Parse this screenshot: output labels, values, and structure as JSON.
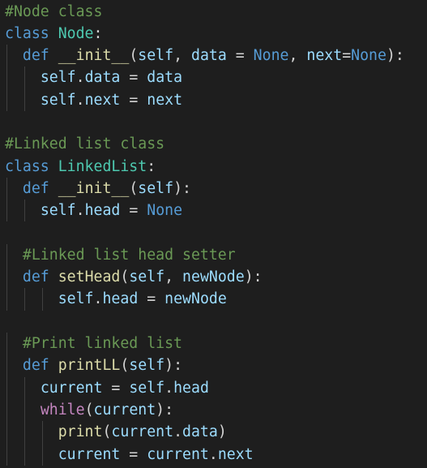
{
  "editor": {
    "colors": {
      "background": "#1e1e1e",
      "comment": "#6a9955",
      "keyword": "#569cd6",
      "class_name": "#4ec9b0",
      "function": "#dcdcaa",
      "variable": "#9cdcfe",
      "control": "#c586c0",
      "text": "#d4d4d4",
      "indent_guide": "#404040"
    },
    "lines": [
      {
        "indent": 0,
        "tokens": [
          {
            "t": "#Node class",
            "c": "comment"
          }
        ]
      },
      {
        "indent": 0,
        "tokens": [
          {
            "t": "class",
            "c": "keyword"
          },
          {
            "t": " ",
            "c": "plain"
          },
          {
            "t": "Node",
            "c": "classname"
          },
          {
            "t": ":",
            "c": "plain"
          }
        ]
      },
      {
        "indent": 1,
        "tokens": [
          {
            "t": "def",
            "c": "keyword"
          },
          {
            "t": " ",
            "c": "plain"
          },
          {
            "t": "__init__",
            "c": "func"
          },
          {
            "t": "(",
            "c": "plain"
          },
          {
            "t": "self",
            "c": "param"
          },
          {
            "t": ", ",
            "c": "plain"
          },
          {
            "t": "data",
            "c": "param"
          },
          {
            "t": " = ",
            "c": "plain"
          },
          {
            "t": "None",
            "c": "const"
          },
          {
            "t": ", ",
            "c": "plain"
          },
          {
            "t": "next",
            "c": "param"
          },
          {
            "t": "=",
            "c": "plain"
          },
          {
            "t": "None",
            "c": "const"
          },
          {
            "t": "):",
            "c": "plain"
          }
        ]
      },
      {
        "indent": 2,
        "tokens": [
          {
            "t": "self",
            "c": "param"
          },
          {
            "t": ".",
            "c": "plain"
          },
          {
            "t": "data",
            "c": "param"
          },
          {
            "t": " = ",
            "c": "plain"
          },
          {
            "t": "data",
            "c": "param"
          }
        ]
      },
      {
        "indent": 2,
        "tokens": [
          {
            "t": "self",
            "c": "param"
          },
          {
            "t": ".",
            "c": "plain"
          },
          {
            "t": "next",
            "c": "param"
          },
          {
            "t": " = ",
            "c": "plain"
          },
          {
            "t": "next",
            "c": "param"
          }
        ]
      },
      {
        "indent": 0,
        "tokens": []
      },
      {
        "indent": 0,
        "tokens": [
          {
            "t": "#Linked list class",
            "c": "comment"
          }
        ]
      },
      {
        "indent": 0,
        "tokens": [
          {
            "t": "class",
            "c": "keyword"
          },
          {
            "t": " ",
            "c": "plain"
          },
          {
            "t": "LinkedList",
            "c": "classname"
          },
          {
            "t": ":",
            "c": "plain"
          }
        ]
      },
      {
        "indent": 1,
        "tokens": [
          {
            "t": "def",
            "c": "keyword"
          },
          {
            "t": " ",
            "c": "plain"
          },
          {
            "t": "__init__",
            "c": "func"
          },
          {
            "t": "(",
            "c": "plain"
          },
          {
            "t": "self",
            "c": "param"
          },
          {
            "t": "):",
            "c": "plain"
          }
        ]
      },
      {
        "indent": 2,
        "tokens": [
          {
            "t": "self",
            "c": "param"
          },
          {
            "t": ".",
            "c": "plain"
          },
          {
            "t": "head",
            "c": "param"
          },
          {
            "t": " = ",
            "c": "plain"
          },
          {
            "t": "None",
            "c": "const"
          }
        ]
      },
      {
        "indent": 0,
        "tokens": []
      },
      {
        "indent": 1,
        "tokens": [
          {
            "t": "#Linked list head setter",
            "c": "comment"
          }
        ]
      },
      {
        "indent": 1,
        "tokens": [
          {
            "t": "def",
            "c": "keyword"
          },
          {
            "t": " ",
            "c": "plain"
          },
          {
            "t": "setHead",
            "c": "func"
          },
          {
            "t": "(",
            "c": "plain"
          },
          {
            "t": "self",
            "c": "param"
          },
          {
            "t": ", ",
            "c": "plain"
          },
          {
            "t": "newNode",
            "c": "param"
          },
          {
            "t": "):",
            "c": "plain"
          }
        ]
      },
      {
        "indent": 3,
        "tokens": [
          {
            "t": "self",
            "c": "param"
          },
          {
            "t": ".",
            "c": "plain"
          },
          {
            "t": "head",
            "c": "param"
          },
          {
            "t": " = ",
            "c": "plain"
          },
          {
            "t": "newNode",
            "c": "param"
          }
        ]
      },
      {
        "indent": 0,
        "tokens": []
      },
      {
        "indent": 1,
        "tokens": [
          {
            "t": "#Print linked list",
            "c": "comment"
          }
        ]
      },
      {
        "indent": 1,
        "tokens": [
          {
            "t": "def",
            "c": "keyword"
          },
          {
            "t": " ",
            "c": "plain"
          },
          {
            "t": "printLL",
            "c": "func"
          },
          {
            "t": "(",
            "c": "plain"
          },
          {
            "t": "self",
            "c": "param"
          },
          {
            "t": "):",
            "c": "plain"
          }
        ]
      },
      {
        "indent": 2,
        "tokens": [
          {
            "t": "current",
            "c": "param"
          },
          {
            "t": " = ",
            "c": "plain"
          },
          {
            "t": "self",
            "c": "param"
          },
          {
            "t": ".",
            "c": "plain"
          },
          {
            "t": "head",
            "c": "param"
          }
        ]
      },
      {
        "indent": 2,
        "tokens": [
          {
            "t": "while",
            "c": "control"
          },
          {
            "t": "(",
            "c": "plain"
          },
          {
            "t": "current",
            "c": "param"
          },
          {
            "t": "):",
            "c": "plain"
          }
        ]
      },
      {
        "indent": 3,
        "tokens": [
          {
            "t": "print",
            "c": "func"
          },
          {
            "t": "(",
            "c": "plain"
          },
          {
            "t": "current",
            "c": "param"
          },
          {
            "t": ".",
            "c": "plain"
          },
          {
            "t": "data",
            "c": "param"
          },
          {
            "t": ")",
            "c": "plain"
          }
        ]
      },
      {
        "indent": 3,
        "tokens": [
          {
            "t": "current",
            "c": "param"
          },
          {
            "t": " = ",
            "c": "plain"
          },
          {
            "t": "current",
            "c": "param"
          },
          {
            "t": ".",
            "c": "plain"
          },
          {
            "t": "next",
            "c": "param"
          }
        ]
      }
    ]
  }
}
